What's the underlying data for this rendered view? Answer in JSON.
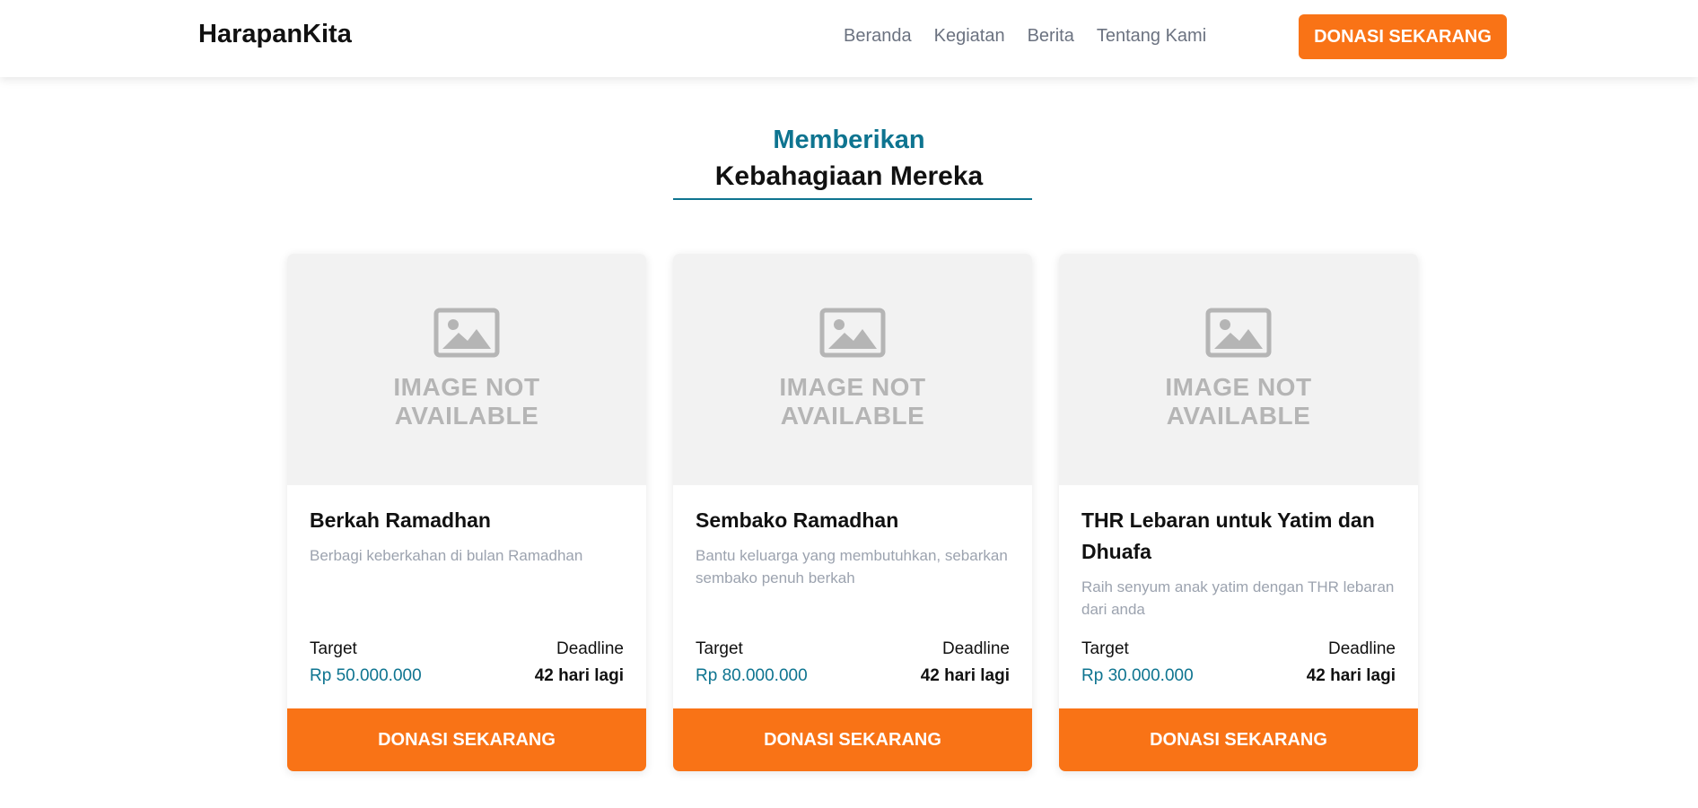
{
  "navbar": {
    "brand": "HarapanKita",
    "links": [
      "Beranda",
      "Kegiatan",
      "Berita",
      "Tentang Kami"
    ],
    "cta_label": "DONASI SEKARANG"
  },
  "section": {
    "accent_title": "Memberikan",
    "main_title": "Kebahagiaan Mereka"
  },
  "placeholder": {
    "line1": "IMAGE NOT",
    "line2": "AVAILABLE",
    "icon": "image-icon"
  },
  "campaigns": [
    {
      "title": "Berkah Ramadhan",
      "description": "Berbagi keberkahan di bulan Ramadhan",
      "target_label": "Target",
      "target_value": "Rp 50.000.000",
      "deadline_label": "Deadline",
      "deadline_value": "42 hari lagi",
      "cta_label": "DONASI SEKARANG"
    },
    {
      "title": "Sembako Ramadhan",
      "description": "Bantu keluarga yang membutuhkan, sebarkan sembako penuh berkah",
      "target_label": "Target",
      "target_value": "Rp 80.000.000",
      "deadline_label": "Deadline",
      "deadline_value": "42 hari lagi",
      "cta_label": "DONASI SEKARANG"
    },
    {
      "title": "THR Lebaran untuk Yatim dan Dhuafa",
      "description": "Raih senyum anak yatim dengan THR lebaran dari anda",
      "target_label": "Target",
      "target_value": "Rp 30.000.000",
      "deadline_label": "Deadline",
      "deadline_value": "42 hari lagi",
      "cta_label": "DONASI SEKARANG"
    }
  ],
  "colors": {
    "accent": "#0e7490",
    "cta": "#f97316",
    "muted_text": "#9ca3af"
  }
}
